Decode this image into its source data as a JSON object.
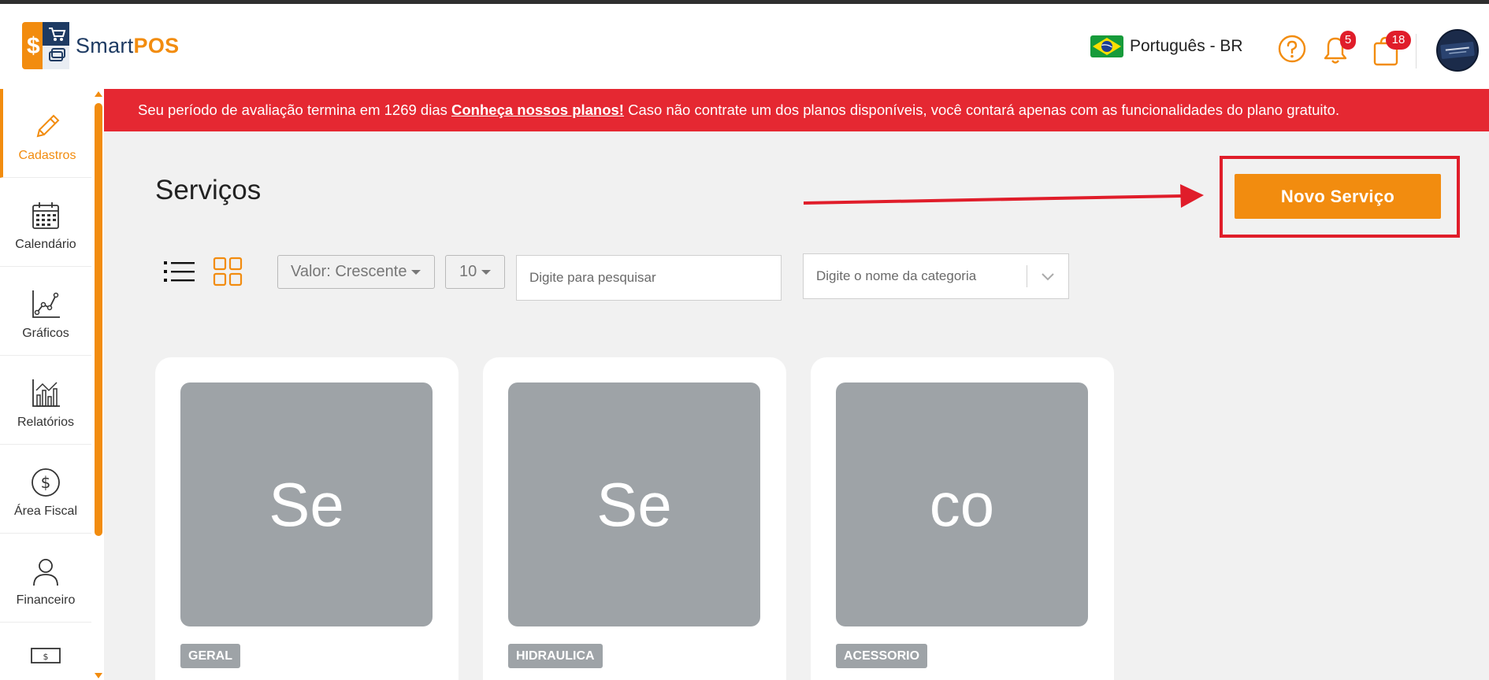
{
  "app": {
    "brand_light": "Smart",
    "brand_bold": "POS"
  },
  "header": {
    "language": "Português - BR",
    "notifications_count": "5",
    "cart_count": "18"
  },
  "sidebar": {
    "items": [
      {
        "label": "Cadastros",
        "icon": "pencil-icon",
        "active": true
      },
      {
        "label": "Calendário",
        "icon": "calendar-icon"
      },
      {
        "label": "Gráficos",
        "icon": "line-chart-icon"
      },
      {
        "label": "Relatórios",
        "icon": "bar-chart-icon"
      },
      {
        "label": "Área Fiscal",
        "icon": "dollar-circle-icon"
      },
      {
        "label": "Financeiro",
        "icon": "person-icon"
      }
    ]
  },
  "banner": {
    "text_before": "Seu período de avaliação termina em 1269 dias ",
    "link": "Conheça nossos planos!",
    "text_after": " Caso não contrate um dos planos disponíveis, você contará apenas com as funcionalidades do plano gratuito."
  },
  "page": {
    "title": "Serviços",
    "new_button": "Novo Serviço"
  },
  "toolbar": {
    "sort_value": "Valor: Crescente",
    "page_size": "10",
    "search_placeholder": "Digite para pesquisar",
    "category_placeholder": "Digite o nome da categoria"
  },
  "cards": [
    {
      "initials": "Se",
      "category": "GERAL"
    },
    {
      "initials": "Se",
      "category": "HIDRAULICA"
    },
    {
      "initials": "co",
      "category": "ACESSORIO"
    }
  ],
  "colors": {
    "accent": "#f28c0f",
    "alert": "#e52832",
    "thumb": "#9ea3a7"
  }
}
